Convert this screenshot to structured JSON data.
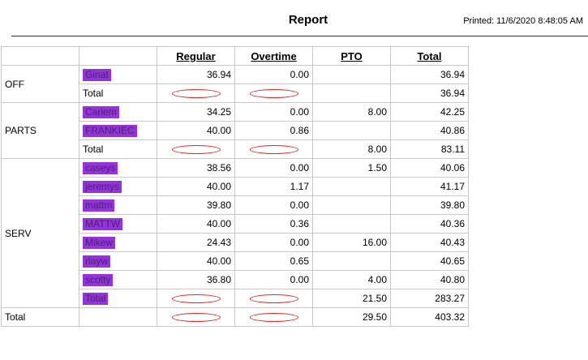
{
  "header": {
    "title": "Report",
    "printed": "Printed: 11/6/2020 8:48:05 AM"
  },
  "columns": [
    "Regular",
    "Overtime",
    "PTO",
    "Total"
  ],
  "rows": [
    {
      "dept": "OFF",
      "name": "Ginat",
      "name_redacted": true,
      "regular": "36.94",
      "overtime": "0.00",
      "pto": "",
      "total": "36.94"
    },
    {
      "dept": "",
      "name": "Total",
      "name_redacted": false,
      "regular": "",
      "overtime": "",
      "pto": "",
      "total": "36.94",
      "values_redacted": true
    },
    {
      "dept": "PARTS",
      "name": "Cariem",
      "name_redacted": true,
      "regular": "34.25",
      "overtime": "0.00",
      "pto": "8.00",
      "total": "42.25"
    },
    {
      "dept": "",
      "name": "FRANKIEC",
      "name_redacted": true,
      "regular": "40.00",
      "overtime": "0.86",
      "pto": "",
      "total": "40.86"
    },
    {
      "dept": "",
      "name": "Total",
      "name_redacted": false,
      "regular": "",
      "overtime": "",
      "pto": "8.00",
      "total": "83.11",
      "values_redacted": true
    },
    {
      "dept": "SERV",
      "name": "caseys",
      "name_redacted": true,
      "regular": "38.56",
      "overtime": "0.00",
      "pto": "1.50",
      "total": "40.06"
    },
    {
      "dept": "",
      "name": "jeremys",
      "name_redacted": true,
      "regular": "40.00",
      "overtime": "1.17",
      "pto": "",
      "total": "41.17"
    },
    {
      "dept": "",
      "name": "mattm",
      "name_redacted": true,
      "regular": "39.80",
      "overtime": "0.00",
      "pto": "",
      "total": "39.80"
    },
    {
      "dept": "",
      "name": "MATTW",
      "name_redacted": true,
      "regular": "40.00",
      "overtime": "0.36",
      "pto": "",
      "total": "40.36"
    },
    {
      "dept": "",
      "name": "Mikew",
      "name_redacted": true,
      "regular": "24.43",
      "overtime": "0.00",
      "pto": "16.00",
      "total": "40.43"
    },
    {
      "dept": "",
      "name": "rlayw",
      "name_redacted": true,
      "regular": "40.00",
      "overtime": "0.65",
      "pto": "",
      "total": "40.65"
    },
    {
      "dept": "",
      "name": "scotty",
      "name_redacted": true,
      "regular": "36.80",
      "overtime": "0.00",
      "pto": "4.00",
      "total": "40.80"
    },
    {
      "dept": "",
      "name": "Total",
      "name_redacted": true,
      "regular": "",
      "overtime": "",
      "pto": "21.50",
      "total": "283.27",
      "values_redacted": true
    },
    {
      "dept": "Total",
      "name": "",
      "name_redacted": false,
      "regular": "",
      "overtime": "",
      "pto": "29.50",
      "total": "403.32",
      "values_redacted": true
    }
  ],
  "colors": {
    "redaction_highlight": "#8a22d6",
    "redaction_mark": "#e0252b"
  }
}
